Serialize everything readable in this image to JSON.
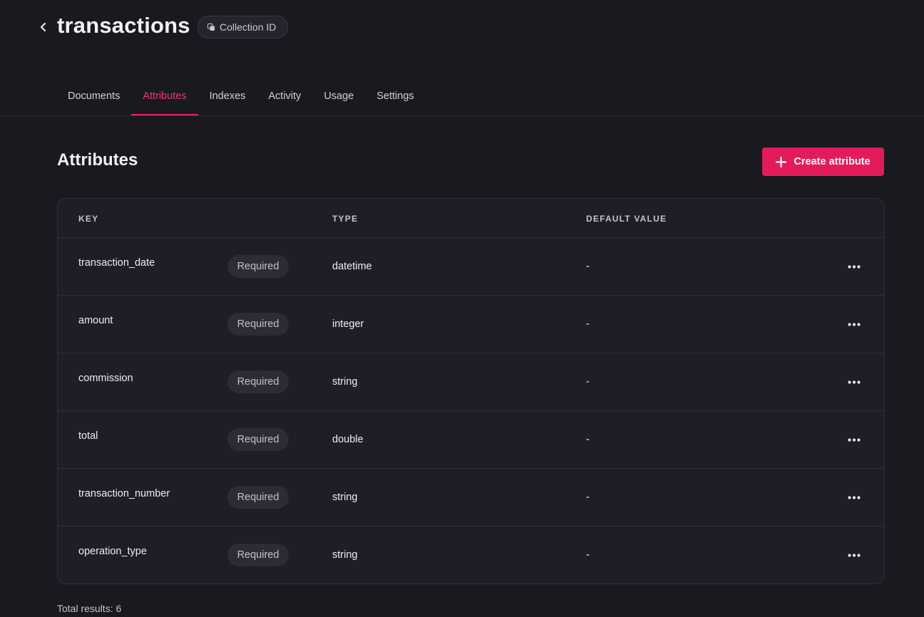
{
  "header": {
    "title": "transactions",
    "collection_id_label": "Collection ID"
  },
  "tabs": [
    {
      "label": "Documents",
      "active": false
    },
    {
      "label": "Attributes",
      "active": true
    },
    {
      "label": "Indexes",
      "active": false
    },
    {
      "label": "Activity",
      "active": false
    },
    {
      "label": "Usage",
      "active": false
    },
    {
      "label": "Settings",
      "active": false
    }
  ],
  "section": {
    "title": "Attributes",
    "create_button_label": "Create attribute"
  },
  "table": {
    "columns": [
      "KEY",
      "TYPE",
      "DEFAULT VALUE"
    ],
    "rows": [
      {
        "key": "transaction_date",
        "badge": "Required",
        "type": "datetime",
        "default": "-"
      },
      {
        "key": "amount",
        "badge": "Required",
        "type": "integer",
        "default": "-"
      },
      {
        "key": "commission",
        "badge": "Required",
        "type": "string",
        "default": "-"
      },
      {
        "key": "total",
        "badge": "Required",
        "type": "double",
        "default": "-"
      },
      {
        "key": "transaction_number",
        "badge": "Required",
        "type": "string",
        "default": "-"
      },
      {
        "key": "operation_type",
        "badge": "Required",
        "type": "string",
        "default": "-"
      }
    ]
  },
  "footer": {
    "total_results": "Total results: 6"
  },
  "colors": {
    "background": "#191920",
    "accent": "#e41b5b",
    "active_tab": "#f0386b",
    "panel": "#1e1e27"
  },
  "icons": {
    "back": "chevron-left-icon",
    "copy": "copy-icon",
    "plus": "plus-icon",
    "more": "more-horizontal-icon"
  }
}
